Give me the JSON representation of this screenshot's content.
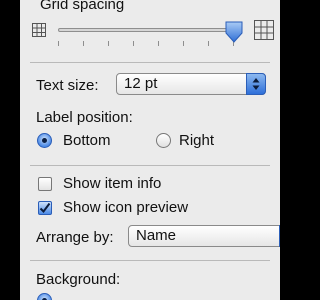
{
  "grid_spacing": {
    "label": "Grid spacing",
    "slider_value": 1.0
  },
  "text_size": {
    "label": "Text size:",
    "selected": "12 pt"
  },
  "label_position": {
    "label": "Label position:",
    "options": [
      "Bottom",
      "Right"
    ],
    "selected": "Bottom"
  },
  "options": {
    "show_item_info": {
      "label": "Show item info",
      "checked": false
    },
    "show_icon_preview": {
      "label": "Show icon preview",
      "checked": true
    }
  },
  "arrange_by": {
    "label": "Arrange by:",
    "selected": "Name"
  },
  "background": {
    "label": "Background:"
  },
  "colors": {
    "accent": "#3b7ae0",
    "panel": "#ebebeb",
    "frame": "#000000"
  }
}
